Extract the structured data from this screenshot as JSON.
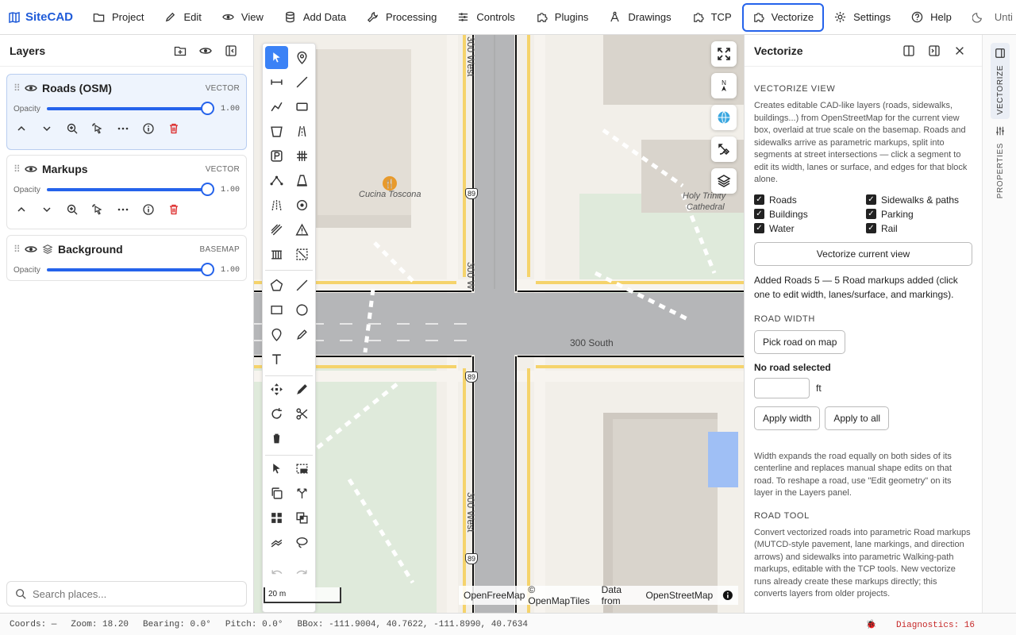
{
  "app": {
    "name": "SiteCAD",
    "doc_title": "Unti"
  },
  "menu": [
    {
      "label": "Project",
      "icon": "folder-icon"
    },
    {
      "label": "Edit",
      "icon": "pencil-icon"
    },
    {
      "label": "View",
      "icon": "eye-icon"
    },
    {
      "label": "Add Data",
      "icon": "database-icon"
    },
    {
      "label": "Processing",
      "icon": "wrench-icon"
    },
    {
      "label": "Controls",
      "icon": "sliders-icon"
    },
    {
      "label": "Plugins",
      "icon": "puzzle-icon"
    },
    {
      "label": "Drawings",
      "icon": "compass-icon"
    },
    {
      "label": "TCP",
      "icon": "puzzle-icon"
    },
    {
      "label": "Vectorize",
      "icon": "puzzle-icon",
      "active": true
    },
    {
      "label": "Settings",
      "icon": "gear-icon"
    },
    {
      "label": "Help",
      "icon": "help-icon"
    }
  ],
  "layers": {
    "title": "Layers",
    "opacity_label": "Opacity",
    "items": [
      {
        "name": "Roads (OSM)",
        "type": "VECTOR",
        "opacity": "1.00",
        "opacity_fraction": 1.0,
        "selected": true
      },
      {
        "name": "Markups",
        "type": "VECTOR",
        "opacity": "1.00",
        "opacity_fraction": 1.0
      },
      {
        "name": "Background",
        "type": "BASEMAP",
        "opacity": "1.00",
        "opacity_fraction": 1.0
      }
    ],
    "search_placeholder": "Search places..."
  },
  "map": {
    "labels": {
      "street_300_west_top": "300 West",
      "street_300_west_mid": "300 W",
      "street_300_west_bottom": "300 West",
      "street_300_south": "300 South",
      "poi_cucina": "Cucina Toscona",
      "poi_holy_trinity_1": "Holy Trinity",
      "poi_holy_trinity_2": "Cathedral",
      "route_shield": "89"
    },
    "attribution_1": "OpenFreeMap",
    "attribution_2": "© OpenMapTiles",
    "attribution_3": "Data from",
    "attribution_4": "OpenStreetMap",
    "scale": "20 m"
  },
  "vectorize": {
    "title": "Vectorize",
    "section_view": "VECTORIZE VIEW",
    "view_desc": "Creates editable CAD-like layers (roads, sidewalks, buildings...) from OpenStreetMap for the current view box, overlaid at true scale on the basemap. Roads and sidewalks arrive as parametric markups, split into segments at street intersections — click a segment to edit its width, lanes or surface, and edges for that block alone.",
    "checks": [
      {
        "label": "Roads",
        "checked": true
      },
      {
        "label": "Sidewalks & paths",
        "checked": true
      },
      {
        "label": "Buildings",
        "checked": true
      },
      {
        "label": "Parking",
        "checked": true
      },
      {
        "label": "Water",
        "checked": true
      },
      {
        "label": "Rail",
        "checked": true
      }
    ],
    "vectorize_btn": "Vectorize current view",
    "result": "Added Roads 5 — 5 Road markups added (click one to edit width, lanes/surface, and markings).",
    "section_width": "ROAD WIDTH",
    "pick_btn": "Pick road on map",
    "no_road": "No road selected",
    "width_value": "",
    "unit": "ft",
    "apply_width": "Apply width",
    "apply_all": "Apply to all",
    "width_desc": "Width expands the road equally on both sides of its centerline and replaces manual shape edits on that road. To reshape a road, use \"Edit geometry\" on its layer in the Layers panel.",
    "section_tool": "ROAD TOOL",
    "tool_desc": "Convert vectorized roads into parametric Road markups (MUTCD-style pavement, lane markings, and direction arrows) and sidewalks into parametric Walking-path markups, editable with the TCP tools. New vectorize runs already create these markups directly; this converts layers from older projects."
  },
  "sidetabs": [
    {
      "label": "VECTORIZE"
    },
    {
      "label": "PROPERTIES"
    }
  ],
  "status": {
    "coords": "Coords: —",
    "zoom": "Zoom: 18.20",
    "bearing": "Bearing: 0.0°",
    "pitch": "Pitch: 0.0°",
    "bbox": "BBox: -111.9004, 40.7622, -111.8990, 40.7634",
    "diagnostics": "Diagnostics: 16"
  },
  "colors": {
    "accent": "#2563eb",
    "danger": "#dc2626",
    "road_yellow": "#f5d36b"
  }
}
